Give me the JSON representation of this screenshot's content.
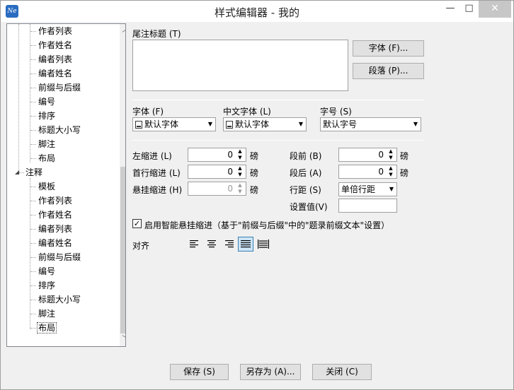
{
  "window": {
    "title": "样式编辑器 - 我的",
    "app_icon_text": "Ne",
    "minimize_glyph": "—",
    "maximize_glyph": "□",
    "close_glyph": "✕"
  },
  "tree": {
    "items": [
      {
        "label": "作者列表",
        "level": 2
      },
      {
        "label": "作者姓名",
        "level": 2
      },
      {
        "label": "编者列表",
        "level": 2
      },
      {
        "label": "编者姓名",
        "level": 2
      },
      {
        "label": "前缀与后缀",
        "level": 2
      },
      {
        "label": "编号",
        "level": 2
      },
      {
        "label": "排序",
        "level": 2
      },
      {
        "label": "标题大小写",
        "level": 2
      },
      {
        "label": "脚注",
        "level": 2
      },
      {
        "label": "布局",
        "level": 2
      },
      {
        "label": "注释",
        "level": 1,
        "expanded": true
      },
      {
        "label": "模板",
        "level": 2
      },
      {
        "label": "作者列表",
        "level": 2
      },
      {
        "label": "作者姓名",
        "level": 2
      },
      {
        "label": "编者列表",
        "level": 2
      },
      {
        "label": "编者姓名",
        "level": 2
      },
      {
        "label": "前缀与后缀",
        "level": 2
      },
      {
        "label": "编号",
        "level": 2
      },
      {
        "label": "排序",
        "level": 2
      },
      {
        "label": "标题大小写",
        "level": 2
      },
      {
        "label": "脚注",
        "level": 2
      },
      {
        "label": "布局",
        "level": 2,
        "selected": true
      }
    ],
    "expander_glyph": "◢",
    "scroll_up": "︿",
    "scroll_down": "﹀"
  },
  "endnote_title": {
    "label": "尾注标题 (T)",
    "value": ""
  },
  "buttons": {
    "font": "字体 (F)...",
    "paragraph": "段落 (P)...",
    "save": "保存 (S)",
    "save_as": "另存为 (A)...",
    "close": "关闭 (C)"
  },
  "font_row": {
    "font_label": "字体 (F)",
    "font_value": "默认字体",
    "cjk_font_label": "中文字体 (L)",
    "cjk_font_value": "默认字体",
    "size_label": "字号 (S)",
    "size_value": "默认字号"
  },
  "indent": {
    "left_label": "左缩进 (L)",
    "left_value": "0",
    "first_label": "首行缩进 (L)",
    "first_value": "0",
    "hanging_label": "悬挂缩进 (H)",
    "hanging_value": "0",
    "unit": "磅"
  },
  "spacing": {
    "before_label": "段前 (B)",
    "before_value": "0",
    "after_label": "段后 (A)",
    "after_value": "0",
    "line_label": "行距 (S)",
    "line_value": "单倍行距",
    "setting_label": "设置值(V)",
    "setting_value": "",
    "unit": "磅"
  },
  "smart_hanging": {
    "checked": true,
    "check_glyph": "✓",
    "label": "启用智能悬挂缩进（基于\"前缀与后缀\"中的\"题录前缀文本\"设置）"
  },
  "alignment": {
    "label": "对齐",
    "options": [
      "left",
      "center",
      "right",
      "justify",
      "distributed"
    ],
    "selected": "justify"
  }
}
